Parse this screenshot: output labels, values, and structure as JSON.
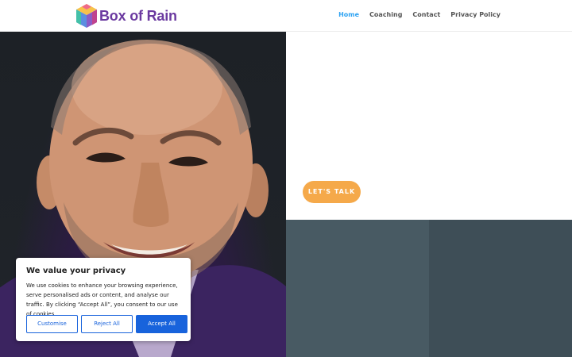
{
  "brand": {
    "name": "Box of Rain"
  },
  "nav": {
    "items": [
      {
        "label": "Home",
        "active": true
      },
      {
        "label": "Coaching",
        "active": false
      },
      {
        "label": "Contact",
        "active": false
      },
      {
        "label": "Privacy Policy",
        "active": false
      }
    ]
  },
  "hero": {
    "cta_label": "LET'S TALK"
  },
  "cookie_banner": {
    "title": "We value your privacy",
    "text": "We use cookies to enhance your browsing experience, serve personalised ads or content, and analyse our traffic. By clicking “Accept All”, you consent to our use of cookies.",
    "customise_label": "Customise",
    "reject_label": "Reject All",
    "accept_label": "Accept All"
  },
  "colors": {
    "nav_active": "#2ea3f2",
    "cta": "#f5a94a",
    "cookie_accent": "#1863dc",
    "slate_panel": "#485a63",
    "brand_text": "#6b3aa0"
  }
}
